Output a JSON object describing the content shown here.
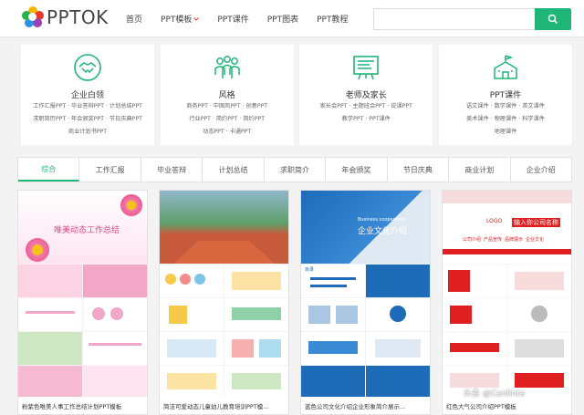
{
  "header": {
    "logo_text": "PPTOK",
    "nav": [
      "首页",
      "PPT模板",
      "PPT课件",
      "PPT图表",
      "PPT教程"
    ],
    "search": {
      "value": "",
      "placeholder": ""
    }
  },
  "categories": [
    {
      "title": "企业白领",
      "icon": "handshake-icon",
      "lines": [
        "工作汇报PPT · 毕业答辩PPT · 计划总结PPT",
        "求职简历PPT · 年会颁奖PPT · 节日庆典PPT",
        "商业计划书PPT"
      ]
    },
    {
      "title": "风格",
      "icon": "people-icon",
      "lines": [
        "商务PPT · 中国风PPT · 创意PPT",
        "行业PPT · 简约PPT · 简约PPT",
        "动态PPT · 卡通PPT"
      ]
    },
    {
      "title": "老师及家长",
      "icon": "teacher-board-icon",
      "lines": [
        "家长会PPT · 主题班会PPT · 说课PPT",
        "教学PPT · PPT课件"
      ]
    },
    {
      "title": "PPT课件",
      "icon": "school-icon",
      "lines": [
        "语文课件 · 数学课件 · 英文课件",
        "美术课件 · 物理课件 · 科学课件",
        "地理课件"
      ]
    }
  ],
  "tabs": [
    "综合",
    "工作汇报",
    "毕业答辩",
    "计划总结",
    "求职简介",
    "年会颁奖",
    "节日庆典",
    "商业计划",
    "企业介绍"
  ],
  "cards": [
    {
      "title": "粉紫色唯美人事工作总结计划PPT模板",
      "slide_text": "唯美动态工作总结"
    },
    {
      "title": "简洁可爱动态儿童幼儿教育培训PPT模...",
      "slide_text": ""
    },
    {
      "title": "蓝色公司文化介绍企业形象简介展示...",
      "slide_text": "企业文化介绍",
      "slide_sub": "Business cooperation",
      "slide_caption": "目录"
    },
    {
      "title": "红色大气公司介绍PPT模板",
      "slide_text": "输入你公司名称",
      "logo": "LOGO",
      "menu": [
        "公司介绍",
        "产品宣传",
        "品牌展示",
        "企业文化"
      ]
    }
  ],
  "watermark": "头条 @Canlinta",
  "colors": {
    "accent": "#1fb678",
    "card1": "#f7a8c8",
    "card3": "#1e6bb8",
    "card4": "#e02020"
  }
}
